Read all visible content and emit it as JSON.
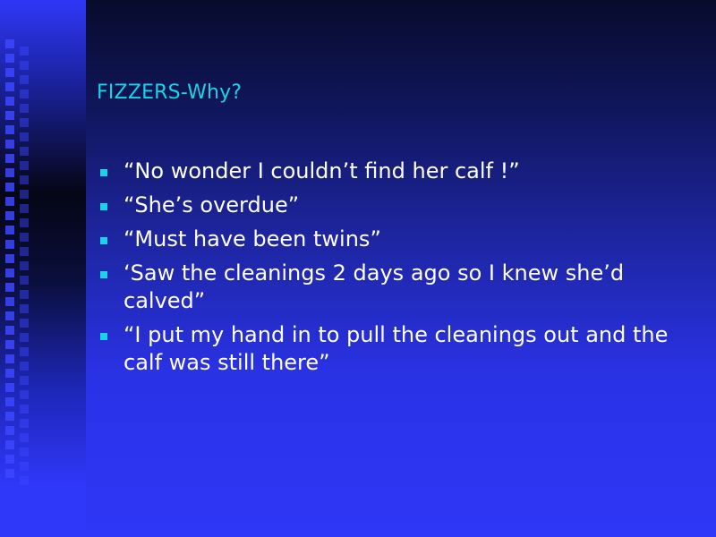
{
  "slide": {
    "title": "FIZZERS-Why?",
    "bullets": [
      "“No wonder I couldn’t  find her calf !”",
      "“She’s overdue”",
      "“Must have been twins”",
      "‘Saw the cleanings 2 days ago so I knew she’d calved”",
      "“I put my hand in to pull the cleanings out and the calf was still there”"
    ]
  },
  "colors": {
    "background": "#2f37f8",
    "title": "#19d3e6",
    "bullet_marker": "#19d3e6",
    "text": "#ffffff"
  }
}
